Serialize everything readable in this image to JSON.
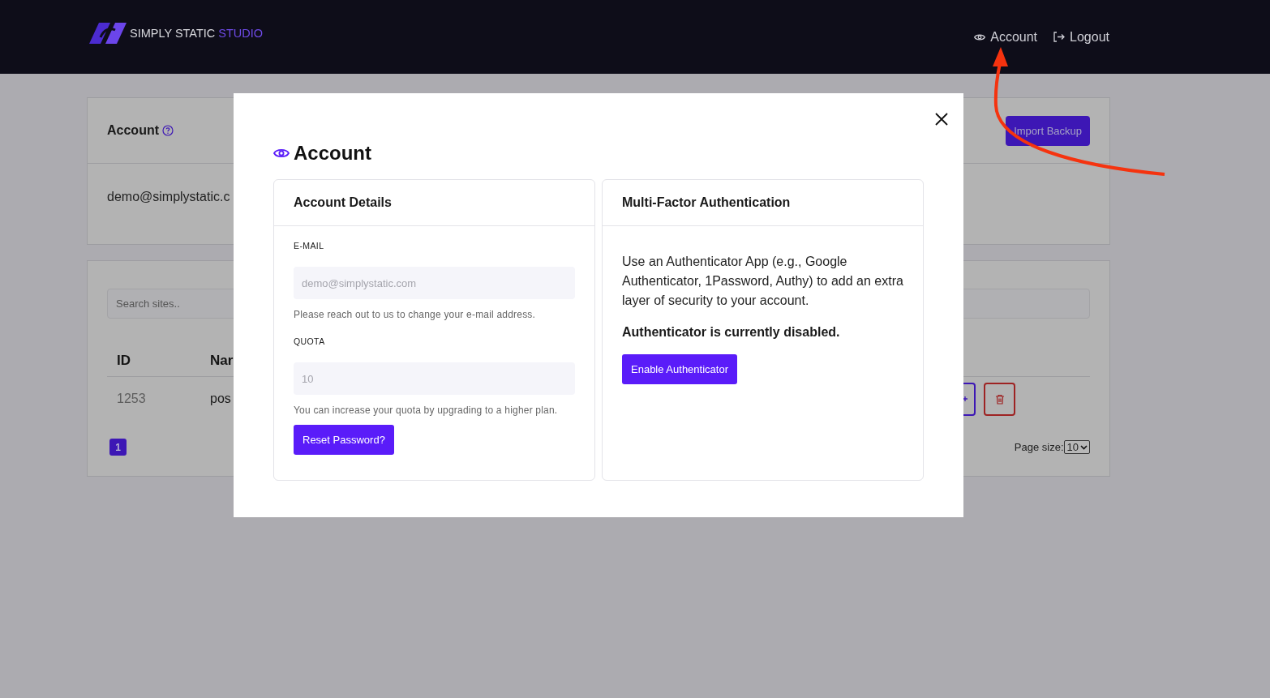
{
  "header": {
    "logo": {
      "brand": "SIMPLY STATIC",
      "accent": "STUDIO"
    },
    "nav": [
      {
        "label": "Account"
      },
      {
        "label": "Logout"
      }
    ]
  },
  "account_card": {
    "title": "Account",
    "action": "Import Backup",
    "email": "demo@simplystatic.c"
  },
  "sites_card": {
    "search": {
      "placeholder": "Search sites.."
    },
    "columns": [
      "ID",
      "Nar"
    ],
    "rows": [
      {
        "id": "1253",
        "name": "pos"
      }
    ],
    "pages": [
      {
        "label": "1",
        "selected": true
      }
    ],
    "page_size": {
      "label": "Page size:",
      "value": "10"
    }
  },
  "modal": {
    "title": "Account",
    "details": {
      "title": "Account Details",
      "fields": [
        {
          "label": "E-MAIL",
          "placeholder": "demo@simplystatic.com",
          "hint": "Please reach out to us to change your e-mail address."
        },
        {
          "label": "QUOTA",
          "placeholder": "10",
          "hint": "You can increase your quota by upgrading to a higher plan."
        }
      ],
      "button": "Reset Password?"
    },
    "mfa": {
      "title": "Multi-Factor Authentication",
      "text": "Use an Authenticator App (e.g., Google Authenticator, 1Password, Authy) to add an extra layer of security to your account.",
      "status": "Authenticator is currently disabled.",
      "enabled": false,
      "button": "Enable Authenticator"
    }
  }
}
